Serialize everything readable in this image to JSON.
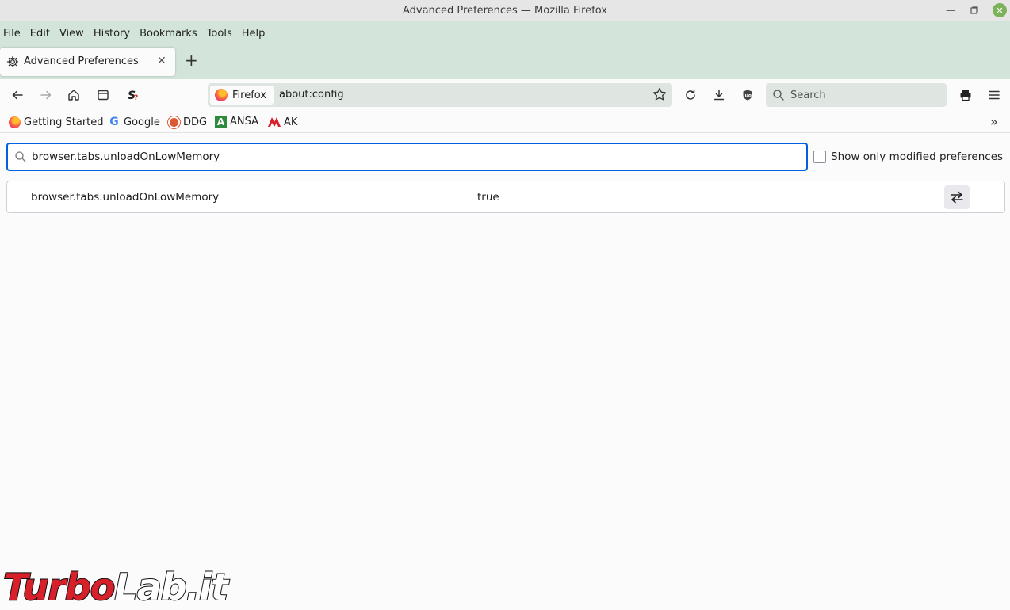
{
  "window": {
    "title": "Advanced Preferences — Mozilla Firefox"
  },
  "menubar": {
    "items": [
      "File",
      "Edit",
      "View",
      "History",
      "Bookmarks",
      "Tools",
      "Help"
    ]
  },
  "tabs": [
    {
      "label": "Advanced Preferences",
      "icon": "gear-icon",
      "active": true
    }
  ],
  "urlbar": {
    "identity_label": "Firefox",
    "url": "about:config"
  },
  "searchbar": {
    "placeholder": "Search"
  },
  "bookmarks": {
    "items": [
      {
        "label": "Getting Started",
        "icon": "firefox-icon"
      },
      {
        "label": "Google",
        "icon": "google-icon"
      },
      {
        "label": "DDG",
        "icon": "duckduckgo-icon"
      },
      {
        "label": "ANSA",
        "icon": "ansa-icon"
      },
      {
        "label": "AK",
        "icon": "ak-icon"
      }
    ]
  },
  "config": {
    "filter_value": "browser.tabs.unloadOnLowMemory",
    "show_modified_label": "Show only modified preferences",
    "show_modified_checked": false,
    "prefs": [
      {
        "name": "browser.tabs.unloadOnLowMemory",
        "value": "true"
      }
    ]
  },
  "watermark": {
    "part1": "Turbo",
    "part2": "Lab.it"
  },
  "colors": {
    "accent": "#0061e0",
    "chrome": "#d3e5da",
    "watermark_red": "#d8202a"
  }
}
